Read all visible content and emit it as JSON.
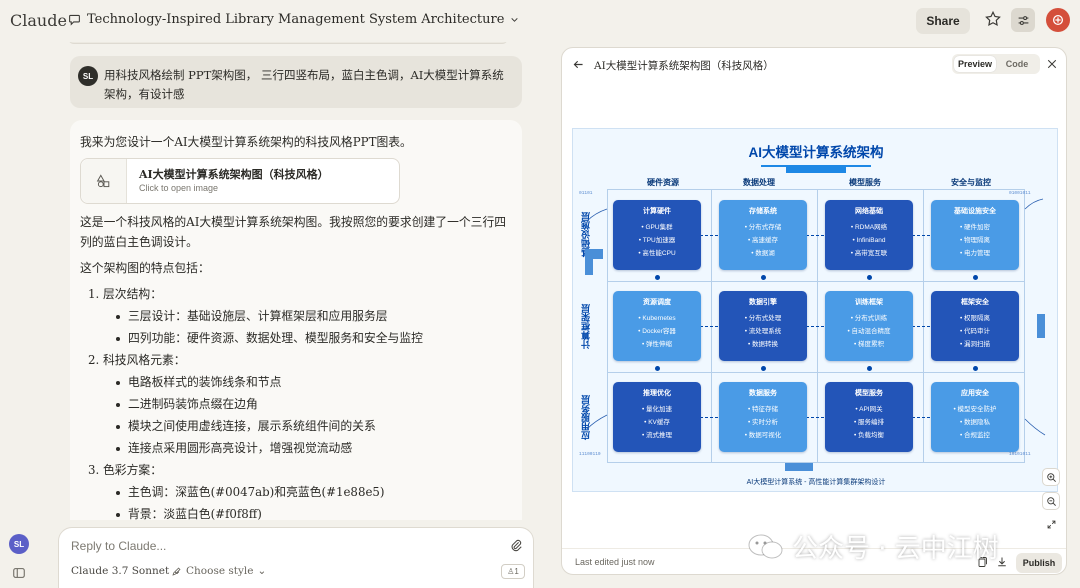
{
  "app": {
    "logo": "Claude",
    "chat_title": "Technology-Inspired Library Management System Architecture",
    "share_label": "Share"
  },
  "user_message": {
    "initials": "SL",
    "text": "用科技风格绘制 PPT架构图， 三行四竖布局，蓝白主色调，AI大模型计算系统架构，有设计感"
  },
  "assistant": {
    "intro": "我来为您设计一个AI大模型计算系统架构的科技风格PPT图表。",
    "artifact_card": {
      "title": "AI大模型计算系统架构图（科技风格）",
      "subtitle": "Click to open image"
    },
    "p1": "这是一个科技风格的AI大模型计算系统架构图。我按照您的要求创建了一个三行四列的蓝白主色调设计。",
    "p2": "这个架构图的特点包括：",
    "sections": [
      {
        "heading": "1. 层次结构：",
        "items": [
          "三层设计：基础设施层、计算框架层和应用服务层",
          "四列功能：硬件资源、数据处理、模型服务和安全与监控"
        ]
      },
      {
        "heading": "2. 科技风格元素：",
        "items": [
          "电路板样式的装饰线条和节点",
          "二进制码装饰点缀在边角",
          "模块之间使用虚线连接，展示系统组件间的关系",
          "连接点采用圆形高亮设计，增强视觉流动感"
        ]
      },
      {
        "heading": "3. 色彩方案：",
        "items": [
          "主色调：深蓝色(#0047ab)和亮蓝色(#1e88e5)",
          "背景：淡蓝白色(#f0f8ff)"
        ]
      }
    ]
  },
  "composer": {
    "placeholder": "Reply to Claude...",
    "model": "Claude 3.7 Sonnet",
    "style": "Choose style",
    "count": "1"
  },
  "sidebar": {
    "initials": "SL"
  },
  "artifact_panel": {
    "title": "AI大模型计算系统架构图（科技风格）",
    "toggle": [
      "Preview",
      "Code"
    ],
    "footer": {
      "edited": "Last edited just now",
      "publish": "Publish"
    }
  },
  "diagram": {
    "title": "AI大模型计算系统架构",
    "columns": [
      "硬件资源",
      "数据处理",
      "模型服务",
      "安全与监控"
    ],
    "rows": [
      "基础设施层",
      "计算框架层",
      "应用服务层"
    ],
    "modules": [
      [
        {
          "h": "计算硬件",
          "i": [
            "• GPU集群",
            "• TPU加速器",
            "• 高性能CPU"
          ]
        },
        {
          "h": "存储系统",
          "i": [
            "• 分布式存储",
            "• 高速缓存",
            "• 数据湖"
          ]
        },
        {
          "h": "网络基础",
          "i": [
            "• RDMA网络",
            "• InfiniBand",
            "• 高带宽互联"
          ]
        },
        {
          "h": "基础设施安全",
          "i": [
            "• 硬件加密",
            "• 物理隔离",
            "• 电力管理"
          ]
        }
      ],
      [
        {
          "h": "资源调度",
          "i": [
            "• Kubernetes",
            "• Docker容器",
            "• 弹性伸缩"
          ]
        },
        {
          "h": "数据引擎",
          "i": [
            "• 分布式处理",
            "• 流处理系统",
            "• 数据转换"
          ]
        },
        {
          "h": "训练框架",
          "i": [
            "• 分布式训练",
            "• 自动混合精度",
            "• 梯度累积"
          ]
        },
        {
          "h": "框架安全",
          "i": [
            "• 权限隔离",
            "• 代码审计",
            "• 漏洞扫描"
          ]
        }
      ],
      [
        {
          "h": "推理优化",
          "i": [
            "• 量化加速",
            "• KV缓存",
            "• 流式推理"
          ]
        },
        {
          "h": "数据服务",
          "i": [
            "• 特征存储",
            "• 实时分析",
            "• 数据可视化"
          ]
        },
        {
          "h": "模型服务",
          "i": [
            "• API网关",
            "• 服务编排",
            "• 负载均衡"
          ]
        },
        {
          "h": "应用安全",
          "i": [
            "• 模型安全防护",
            "• 数据隐私",
            "• 合规监控"
          ]
        }
      ]
    ],
    "footer": "AI大模型计算系统 - 高性能计算集群架构设计",
    "binary": [
      "01101",
      "01001011",
      "11100110",
      "10101011"
    ]
  },
  "watermark": "公众号 · 云中江树"
}
